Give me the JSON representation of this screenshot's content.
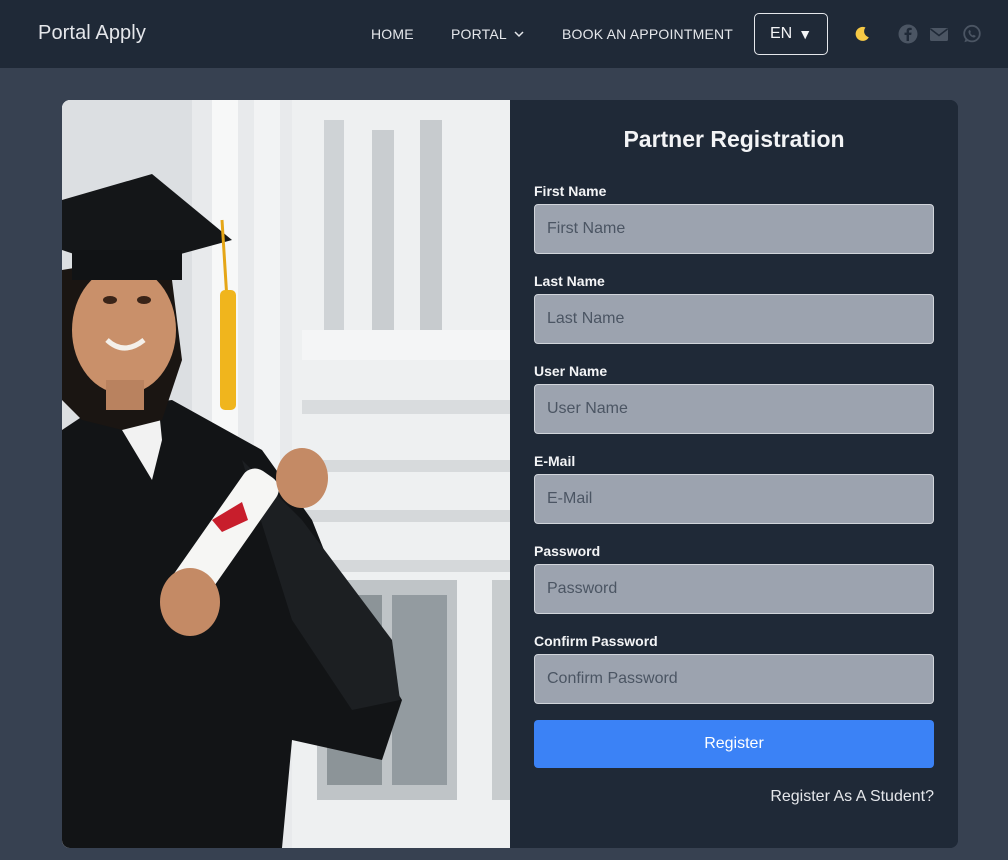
{
  "navbar": {
    "brand": "Portal Apply",
    "links": {
      "home": "HOME",
      "portal": "PORTAL",
      "book": "BOOK AN APPOINTMENT"
    },
    "language": "EN",
    "language_caret": "▼",
    "icons": [
      "moon-icon",
      "facebook-icon",
      "mail-icon",
      "whatsapp-icon"
    ]
  },
  "form": {
    "title": "Partner Registration",
    "fields": [
      {
        "label": "First Name",
        "placeholder": "First Name",
        "value": ""
      },
      {
        "label": "Last Name",
        "placeholder": "Last Name",
        "value": ""
      },
      {
        "label": "User Name",
        "placeholder": "User Name",
        "value": ""
      },
      {
        "label": "E-Mail",
        "placeholder": "E-Mail",
        "value": ""
      },
      {
        "label": "Password",
        "placeholder": "Password",
        "value": ""
      },
      {
        "label": "Confirm Password",
        "placeholder": "Confirm Password",
        "value": ""
      }
    ],
    "submit_label": "Register",
    "student_link": "Register As A Student?"
  },
  "colors": {
    "page_bg": "#374151",
    "navbar_bg": "#1f2937",
    "panel_bg": "#1f2937",
    "input_bg": "#9ca3af",
    "accent": "#3b82f6"
  }
}
